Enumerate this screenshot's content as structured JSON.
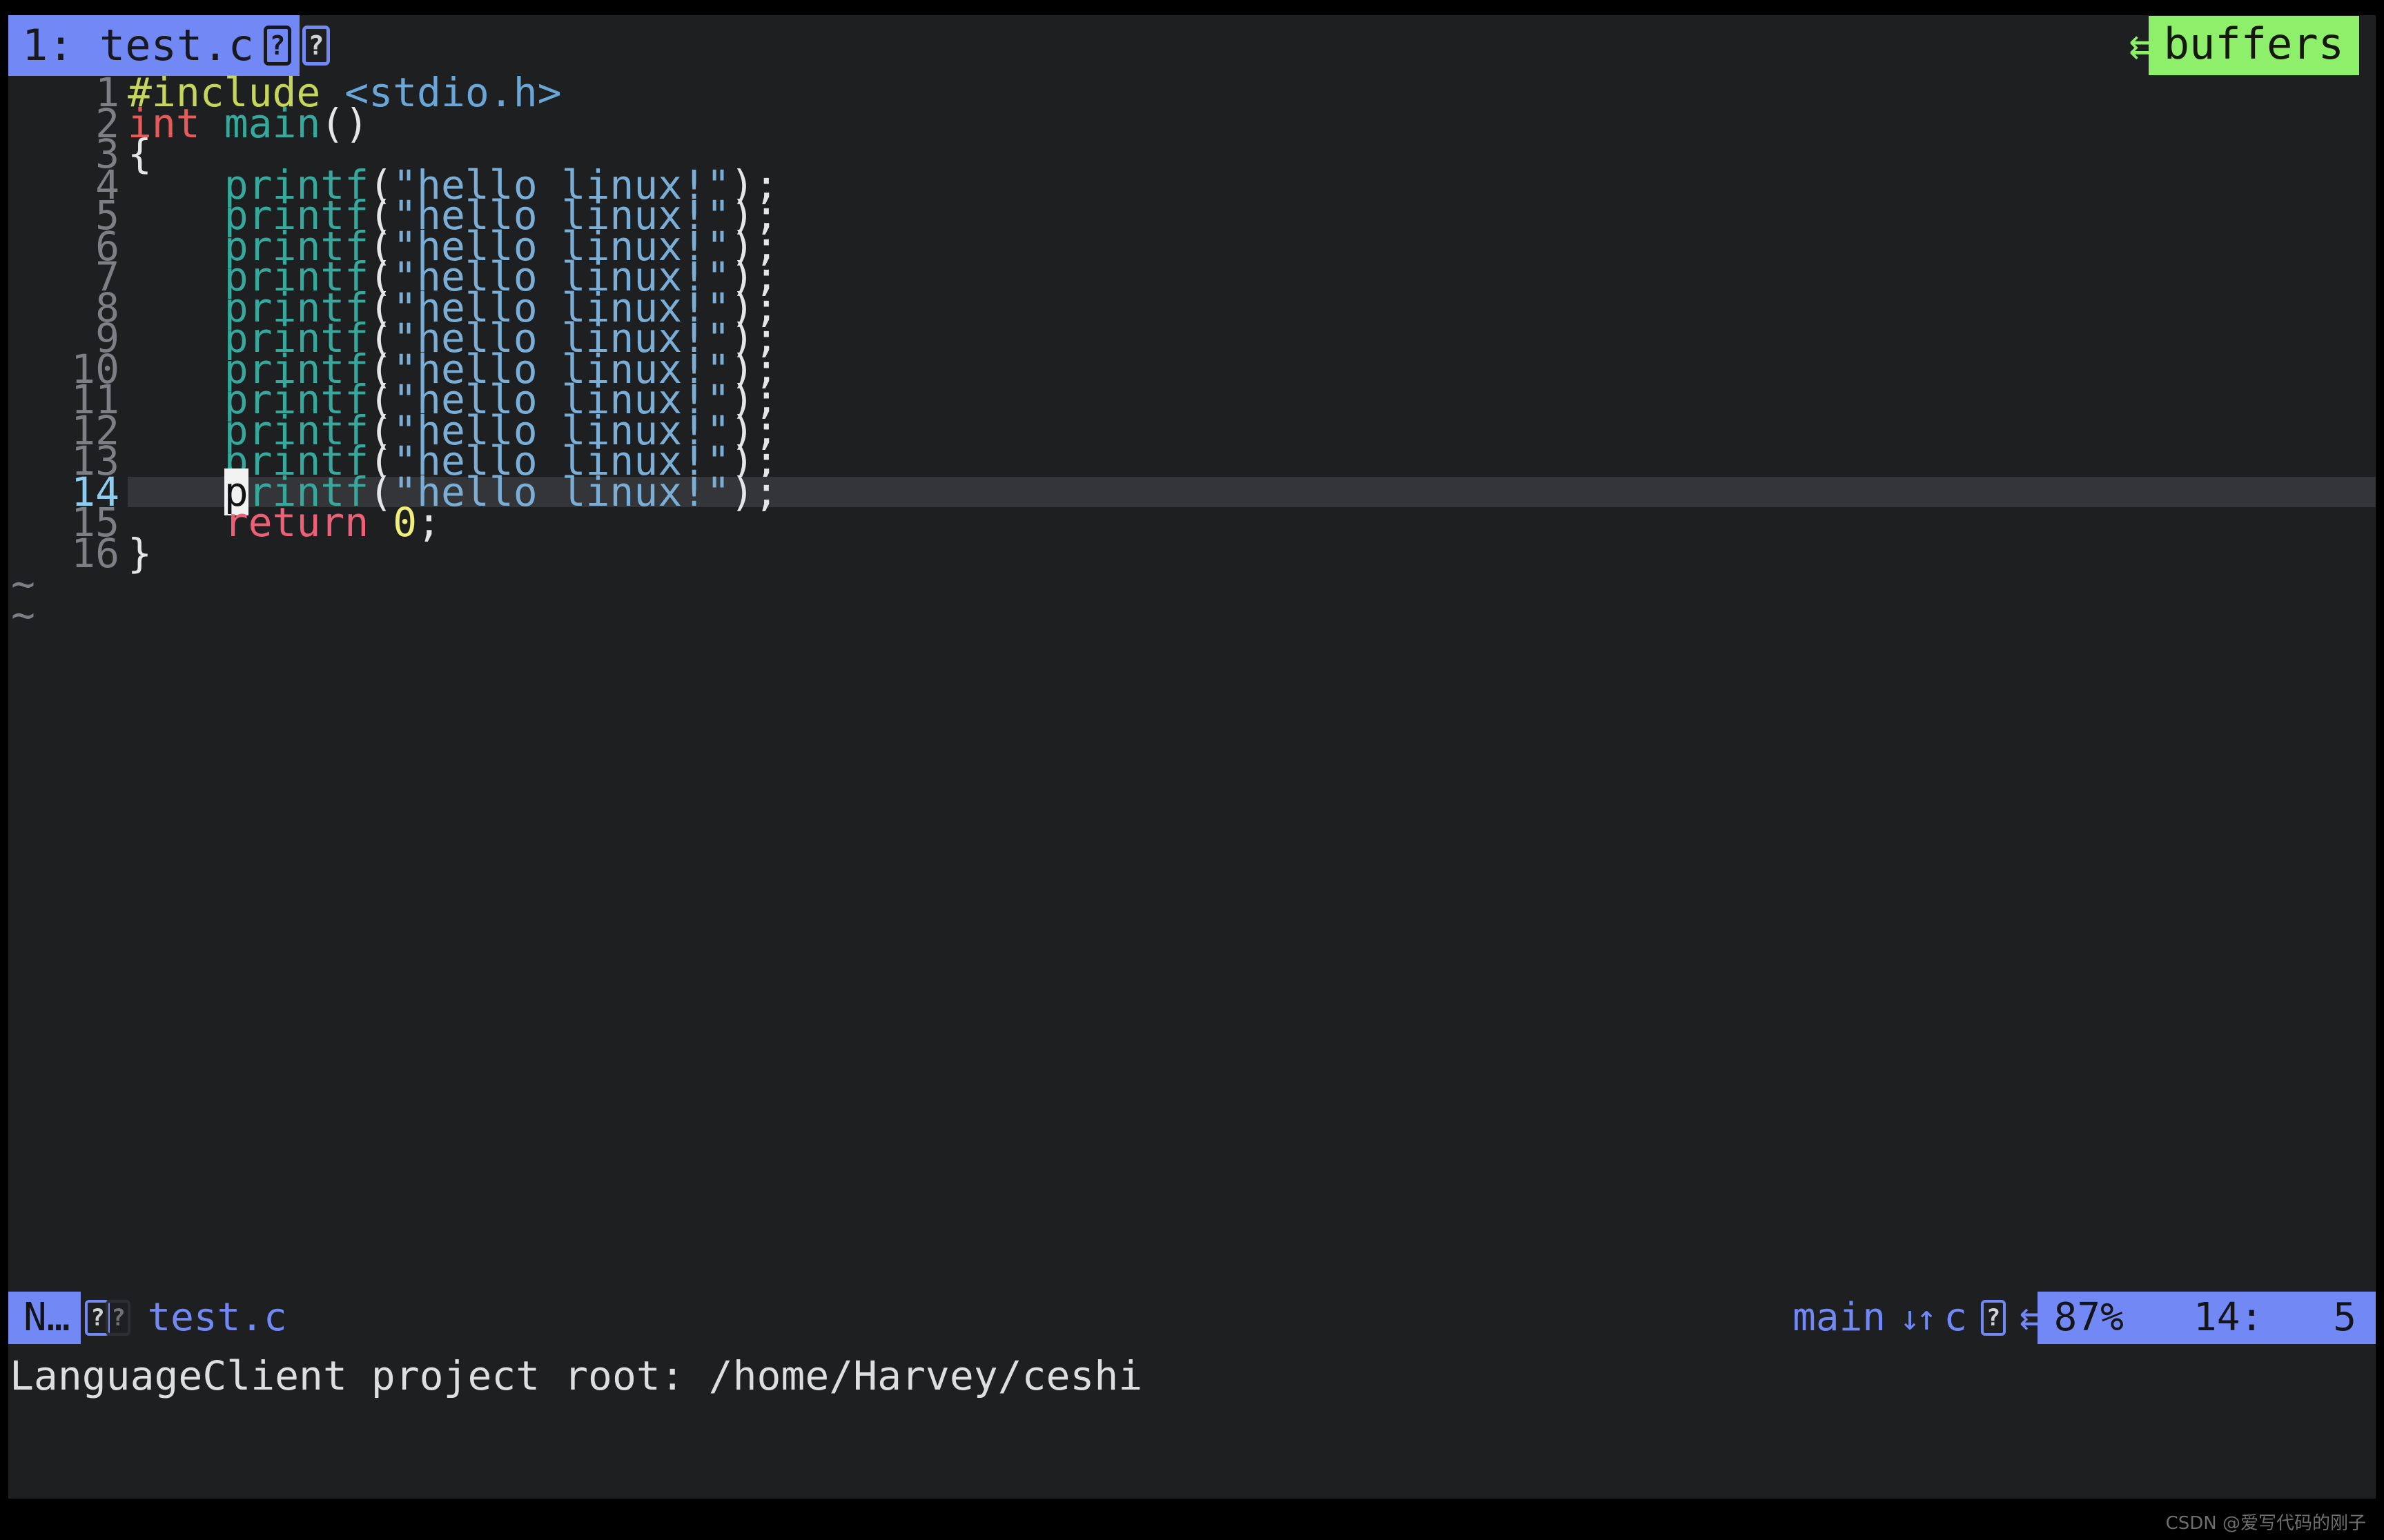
{
  "tabline": {
    "active_tab": "1: test.c",
    "tab_icon_1": "?",
    "tab_icon_2": "?",
    "separator_icon": "⇇",
    "buffers_label": "buffers",
    "colors": {
      "active_tab_bg": "#7289f5",
      "active_tab_fg": "#18191c",
      "buffers_bg": "#8ef06a",
      "buffers_fg": "#16180f",
      "tabline_bg": "#1d1f21"
    }
  },
  "editor": {
    "background": "#1d1f21",
    "cursorline_bg": "#333538",
    "line_number_fg": "#7c7f84",
    "cursor_line_number_fg": "#8fcdf0",
    "cursor": {
      "char": "p",
      "line": 14,
      "column": 5,
      "bg": "#f2f2f2",
      "fg": "#111214"
    },
    "filler_char": "~",
    "filler_rows": 2,
    "lines": [
      {
        "num": "1",
        "indent": "",
        "tokens": [
          {
            "t": "#include ",
            "c": "t-green"
          },
          {
            "t": "<stdio.h>",
            "c": "t-blue"
          }
        ]
      },
      {
        "num": "2",
        "indent": "",
        "tokens": [
          {
            "t": "int ",
            "c": "t-red"
          },
          {
            "t": "main",
            "c": "t-teal"
          },
          {
            "t": "()",
            "c": "t-white"
          }
        ]
      },
      {
        "num": "3",
        "indent": "",
        "tokens": [
          {
            "t": "{",
            "c": "t-white"
          }
        ]
      },
      {
        "num": "4",
        "indent": "    ",
        "tokens": [
          {
            "t": "printf",
            "c": "t-teal"
          },
          {
            "t": "(",
            "c": "t-white"
          },
          {
            "t": "\"hello linux!\"",
            "c": "t-str"
          },
          {
            "t": ");",
            "c": "t-white"
          }
        ]
      },
      {
        "num": "5",
        "indent": "    ",
        "tokens": [
          {
            "t": "printf",
            "c": "t-teal"
          },
          {
            "t": "(",
            "c": "t-white"
          },
          {
            "t": "\"hello linux!\"",
            "c": "t-str"
          },
          {
            "t": ");",
            "c": "t-white"
          }
        ]
      },
      {
        "num": "6",
        "indent": "    ",
        "tokens": [
          {
            "t": "printf",
            "c": "t-teal"
          },
          {
            "t": "(",
            "c": "t-white"
          },
          {
            "t": "\"hello linux!\"",
            "c": "t-str"
          },
          {
            "t": ");",
            "c": "t-white"
          }
        ]
      },
      {
        "num": "7",
        "indent": "    ",
        "tokens": [
          {
            "t": "printf",
            "c": "t-teal"
          },
          {
            "t": "(",
            "c": "t-white"
          },
          {
            "t": "\"hello linux!\"",
            "c": "t-str"
          },
          {
            "t": ");",
            "c": "t-white"
          }
        ]
      },
      {
        "num": "8",
        "indent": "    ",
        "tokens": [
          {
            "t": "printf",
            "c": "t-teal"
          },
          {
            "t": "(",
            "c": "t-white"
          },
          {
            "t": "\"hello linux!\"",
            "c": "t-str"
          },
          {
            "t": ");",
            "c": "t-white"
          }
        ]
      },
      {
        "num": "9",
        "indent": "    ",
        "tokens": [
          {
            "t": "printf",
            "c": "t-teal"
          },
          {
            "t": "(",
            "c": "t-white"
          },
          {
            "t": "\"hello linux!\"",
            "c": "t-str"
          },
          {
            "t": ");",
            "c": "t-white"
          }
        ]
      },
      {
        "num": "10",
        "indent": "    ",
        "tokens": [
          {
            "t": "printf",
            "c": "t-teal"
          },
          {
            "t": "(",
            "c": "t-white"
          },
          {
            "t": "\"hello linux!\"",
            "c": "t-str"
          },
          {
            "t": ");",
            "c": "t-white"
          }
        ]
      },
      {
        "num": "11",
        "indent": "    ",
        "tokens": [
          {
            "t": "printf",
            "c": "t-teal"
          },
          {
            "t": "(",
            "c": "t-white"
          },
          {
            "t": "\"hello linux!\"",
            "c": "t-str"
          },
          {
            "t": ");",
            "c": "t-white"
          }
        ]
      },
      {
        "num": "12",
        "indent": "    ",
        "tokens": [
          {
            "t": "printf",
            "c": "t-teal"
          },
          {
            "t": "(",
            "c": "t-white"
          },
          {
            "t": "\"hello linux!\"",
            "c": "t-str"
          },
          {
            "t": ");",
            "c": "t-white"
          }
        ]
      },
      {
        "num": "13",
        "indent": "    ",
        "tokens": [
          {
            "t": "printf",
            "c": "t-teal"
          },
          {
            "t": "(",
            "c": "t-white"
          },
          {
            "t": "\"hello linux!\"",
            "c": "t-str"
          },
          {
            "t": ");",
            "c": "t-white"
          }
        ]
      },
      {
        "num": "14",
        "indent": "    ",
        "cursor": true,
        "tokens": [
          {
            "t": "p",
            "c": "cursor-block"
          },
          {
            "t": "rintf",
            "c": "t-teal"
          },
          {
            "t": "(",
            "c": "t-white"
          },
          {
            "t": "\"hello linux!\"",
            "c": "t-str"
          },
          {
            "t": ");",
            "c": "t-white"
          }
        ]
      },
      {
        "num": "15",
        "indent": "    ",
        "tokens": [
          {
            "t": "return ",
            "c": "t-pink"
          },
          {
            "t": "0",
            "c": "t-yellow"
          },
          {
            "t": ";",
            "c": "t-white"
          }
        ]
      },
      {
        "num": "16",
        "indent": "",
        "tokens": [
          {
            "t": "}",
            "c": "t-white"
          }
        ]
      }
    ]
  },
  "statusline": {
    "mode": "N…",
    "icon_1": "?",
    "icon_2": "?",
    "filename": "test.c",
    "function": "main",
    "scroll_icon": "↓↑",
    "filetype": "c",
    "filetype_icon": "?",
    "separator_icon": "⇇",
    "percent": "87%",
    "position": "14:   5",
    "colors": {
      "mode_bg": "#7289f5",
      "mode_fg": "#141519",
      "accent_fg": "#7289f5",
      "bg": "#1d1f21"
    }
  },
  "message": {
    "text": "LanguageClient project root: /home/Harvey/ceshi"
  },
  "watermark": {
    "text": "CSDN @爱写代码的刚子"
  }
}
